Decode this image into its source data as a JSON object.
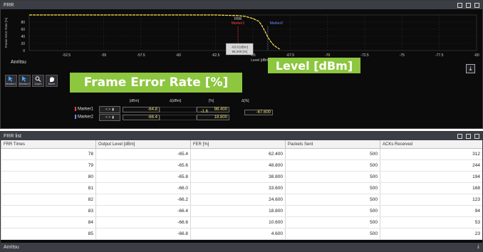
{
  "frr_panel": {
    "title": "FRR",
    "logo": "Anritsu",
    "tools": [
      {
        "label": "Marker1",
        "icon": "cursor-icon"
      },
      {
        "label": "Marker2",
        "icon": "cursor-icon"
      },
      {
        "label": "Zoom",
        "icon": "magnifier-icon"
      },
      {
        "label": "Move",
        "icon": "hand-icon"
      }
    ],
    "download_icon": "download-icon"
  },
  "chart_data": {
    "type": "line",
    "title": "FRR",
    "xlabel": "Level [dBm]",
    "ylabel": "Frame Error Rate [%]",
    "xlim": [
      -50,
      -80
    ],
    "ylim": [
      0,
      100
    ],
    "x_ticks": [
      "-52.5",
      "-55",
      "-57.5",
      "-60",
      "-62.5",
      "-65",
      "-67.5",
      "-70",
      "-72.5",
      "-75",
      "-77.5",
      "-80"
    ],
    "y_ticks": [
      "0",
      "20",
      "40",
      "60",
      "80"
    ],
    "grid": true,
    "series": [
      {
        "name": "FRR",
        "color": "#ffe84a",
        "x": [
          -50,
          -52.5,
          -55,
          -57.5,
          -60,
          -62.5,
          -64.0,
          -64.5,
          -65.0,
          -65.4,
          -65.6,
          -65.8,
          -66.0,
          -66.2,
          -66.4,
          -66.6,
          -66.8
        ],
        "y": [
          100,
          100,
          100,
          100,
          100,
          100,
          98,
          96,
          90,
          82,
          70,
          55,
          38,
          25,
          15,
          9,
          4
        ]
      }
    ],
    "markers": [
      {
        "name": "Marker1",
        "color": "#ff4040",
        "x": -64.0
      },
      {
        "name": "Marker2",
        "color": "#6e8bff",
        "x": -66.0
      }
    ],
    "tooltip": {
      "line1": "-63.8 [dBm]",
      "line2": "98.200 [%]"
    }
  },
  "callouts": {
    "frame_error_rate": "Frame Error Rate [%]",
    "level": "Level [dBm]"
  },
  "marker_table": {
    "headers": {
      "dbm": "[dBm]",
      "delta_dbm": "Δ[dBm]",
      "pct": "[%]",
      "delta_pct": "Δ[%]"
    },
    "rows": [
      {
        "name": "Marker1",
        "color": "#ff4040",
        "dbm": "-64.8",
        "pct": "98.400"
      },
      {
        "name": "Marker2",
        "color": "#6e8bff",
        "dbm": "-66.4",
        "pct": "18.800"
      }
    ],
    "delta_dbm": "-1.6",
    "delta_pct": "-67.600",
    "nav_label": "< >"
  },
  "list_panel": {
    "title": "FRR list",
    "logo": "Anritsu",
    "columns": [
      "FRR Times",
      "Output Level [dBm]",
      "FER [%]",
      "Packets Sent",
      "ACKs Received"
    ],
    "rows": [
      [
        "78",
        "-65.4",
        "62.400",
        "500",
        "312"
      ],
      [
        "79",
        "-65.6",
        "48.800",
        "500",
        "244"
      ],
      [
        "80",
        "-65.8",
        "38.800",
        "500",
        "194"
      ],
      [
        "81",
        "-66.0",
        "33.600",
        "500",
        "168"
      ],
      [
        "82",
        "-66.2",
        "24.600",
        "500",
        "123"
      ],
      [
        "83",
        "-66.4",
        "18.800",
        "500",
        "94"
      ],
      [
        "84",
        "-66.6",
        "10.600",
        "500",
        "53"
      ],
      [
        "85",
        "-66.8",
        "4.600",
        "500",
        "23"
      ]
    ]
  }
}
